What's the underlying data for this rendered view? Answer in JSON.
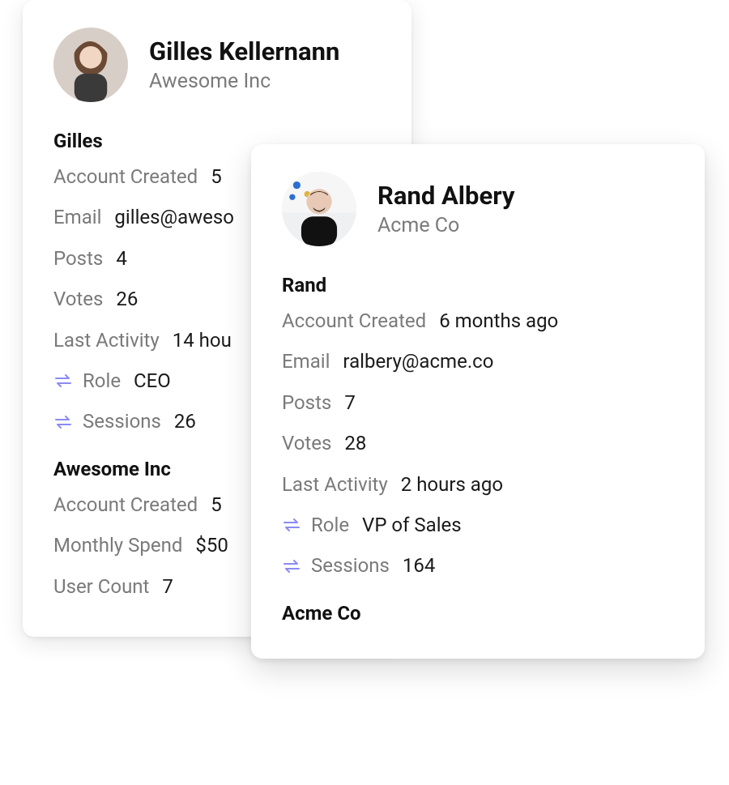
{
  "cards": [
    {
      "name": "Gilles Kellernann",
      "company": "Awesome Inc",
      "person_section": {
        "title": "Gilles",
        "rows": [
          {
            "label": "Account Created",
            "value": "5",
            "sync": false
          },
          {
            "label": "Email",
            "value": "gilles@aweso",
            "sync": false
          },
          {
            "label": "Posts",
            "value": "4",
            "sync": false
          },
          {
            "label": "Votes",
            "value": "26",
            "sync": false
          },
          {
            "label": "Last Activity",
            "value": "14 hou",
            "sync": false
          },
          {
            "label": "Role",
            "value": "CEO",
            "sync": true
          },
          {
            "label": "Sessions",
            "value": "26",
            "sync": true
          }
        ]
      },
      "company_section": {
        "title": "Awesome Inc",
        "rows": [
          {
            "label": "Account Created",
            "value": "5",
            "sync": false
          },
          {
            "label": "Monthly Spend",
            "value": "$50",
            "sync": false
          },
          {
            "label": "User Count",
            "value": "7",
            "sync": false
          }
        ]
      }
    },
    {
      "name": "Rand Albery",
      "company": "Acme Co",
      "person_section": {
        "title": "Rand",
        "rows": [
          {
            "label": "Account Created",
            "value": "6 months ago",
            "sync": false
          },
          {
            "label": "Email",
            "value": "ralbery@acme.co",
            "sync": false
          },
          {
            "label": "Posts",
            "value": "7",
            "sync": false
          },
          {
            "label": "Votes",
            "value": "28",
            "sync": false
          },
          {
            "label": "Last Activity",
            "value": "2 hours ago",
            "sync": false
          },
          {
            "label": "Role",
            "value": "VP of Sales",
            "sync": true
          },
          {
            "label": "Sessions",
            "value": "164",
            "sync": true
          }
        ]
      },
      "company_section": {
        "title": "Acme Co",
        "rows": []
      }
    }
  ]
}
